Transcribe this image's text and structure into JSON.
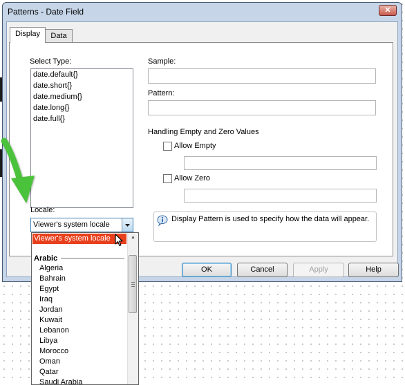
{
  "window": {
    "title": "Patterns - Date Field",
    "close_glyph": "✕"
  },
  "tabs": [
    {
      "label": "Display",
      "active": true
    },
    {
      "label": "Data",
      "active": false
    }
  ],
  "select_type": {
    "label": "Select Type:",
    "items": [
      "date.default{}",
      "date.short{}",
      "date.medium{}",
      "date.long{}",
      "date.full{}"
    ]
  },
  "sample": {
    "label": "Sample:",
    "value": ""
  },
  "pattern": {
    "label": "Pattern:",
    "value": ""
  },
  "handling": {
    "heading": "Handling Empty and Zero Values",
    "allow_empty": {
      "label": "Allow Empty",
      "checked": false,
      "value": ""
    },
    "allow_zero": {
      "label": "Allow Zero",
      "checked": false,
      "value": ""
    }
  },
  "locale": {
    "label": "Locale:",
    "selected": "Viewer's system locale"
  },
  "info": {
    "icon": "info-speech-icon",
    "text": "Display Pattern is used to specify how the data will appear."
  },
  "buttons": {
    "ok": "OK",
    "cancel": "Cancel",
    "apply": "Apply",
    "help": "Help"
  },
  "dropdown": {
    "selected": "Viewer's system locale",
    "group": "Arabic",
    "items": [
      "Algeria",
      "Bahrain",
      "Egypt",
      "Iraq",
      "Jordan",
      "Kuwait",
      "Lebanon",
      "Libya",
      "Morocco",
      "Oman",
      "Qatar",
      "Saudi Arabia"
    ]
  },
  "colors": {
    "accent_arrow": "#4cc23a",
    "selection": "#e8401c",
    "window_frame": "#c6d6e8"
  }
}
